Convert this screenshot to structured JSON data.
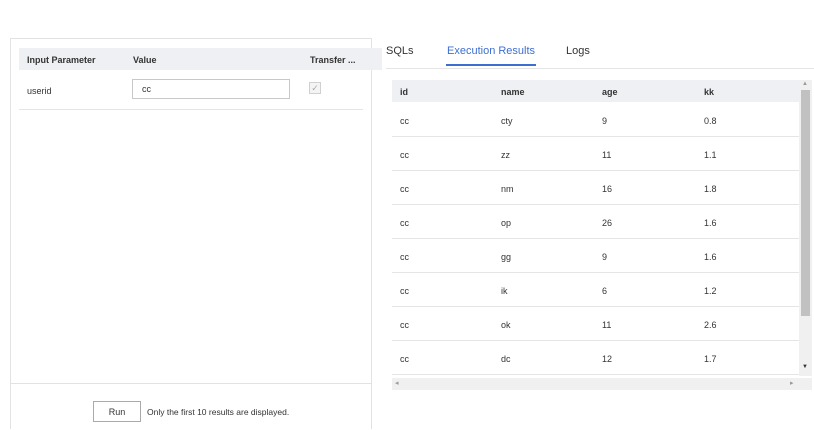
{
  "params": {
    "headers": [
      "Input Parameter",
      "Value",
      "Transfer ..."
    ],
    "rows": [
      {
        "name": "userid",
        "value": "cc",
        "transfer": true
      }
    ]
  },
  "footer": {
    "run_label": "Run",
    "note": "Only the first 10 results are displayed."
  },
  "tabs": [
    "SQLs",
    "Execution Results",
    "Logs"
  ],
  "active_tab": "Execution Results",
  "results": {
    "columns": [
      "id",
      "name",
      "age",
      "kk"
    ],
    "rows": [
      [
        "cc",
        "cty",
        "9",
        "0.8"
      ],
      [
        "cc",
        "zz",
        "11",
        "1.1"
      ],
      [
        "cc",
        "nm",
        "16",
        "1.8"
      ],
      [
        "cc",
        "op",
        "26",
        "1.6"
      ],
      [
        "cc",
        "gg",
        "9",
        "1.6"
      ],
      [
        "cc",
        "ik",
        "6",
        "1.2"
      ],
      [
        "cc",
        "ok",
        "11",
        "2.6"
      ],
      [
        "cc",
        "dc",
        "12",
        "1.7"
      ]
    ]
  },
  "colors": {
    "accent": "#3e6fd0",
    "header_bg": "#eef0f4"
  }
}
